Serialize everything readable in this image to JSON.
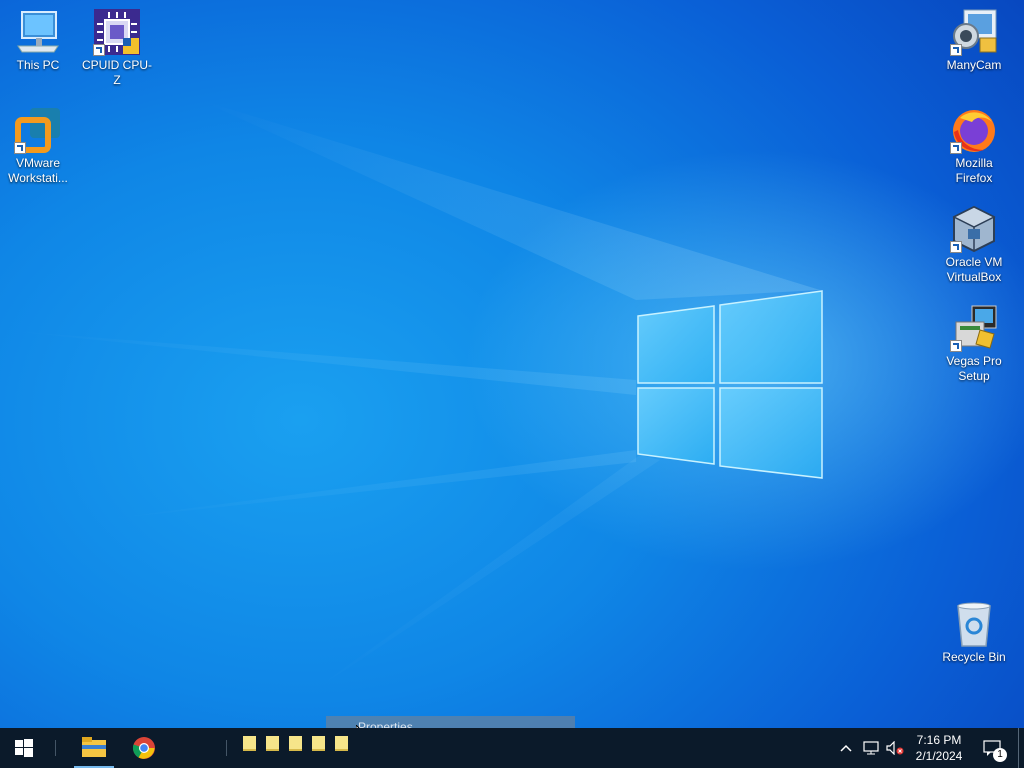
{
  "desktop": {
    "icons": [
      {
        "label": "This PC",
        "icon": "this-pc-icon"
      },
      {
        "label": "CPUID CPU-Z",
        "icon": "cpu-z-icon"
      },
      {
        "label": "VMware Workstati...",
        "icon": "vmware-icon"
      },
      {
        "label": "ManyCam",
        "icon": "manycam-icon"
      },
      {
        "label": "Mozilla Firefox",
        "icon": "firefox-icon"
      },
      {
        "label": "Oracle VM VirtualBox",
        "icon": "virtualbox-icon"
      },
      {
        "label": "Vegas Pro Setup",
        "icon": "vegas-setup-icon"
      },
      {
        "label": "Recycle Bin",
        "icon": "recycle-bin-icon"
      }
    ]
  },
  "tooltip": {
    "text": "Properties"
  },
  "taskbar": {
    "start_icon": "windows-start-icon",
    "pinned": [
      "file-explorer-icon",
      "chrome-icon"
    ],
    "sticky_notes_count": 5,
    "tray": {
      "time": "7:16 PM",
      "date": "2/1/2024",
      "notification_count": "1"
    }
  },
  "colors": {
    "taskbar": "#0b1a2a",
    "accent": "#1aa0f0"
  }
}
